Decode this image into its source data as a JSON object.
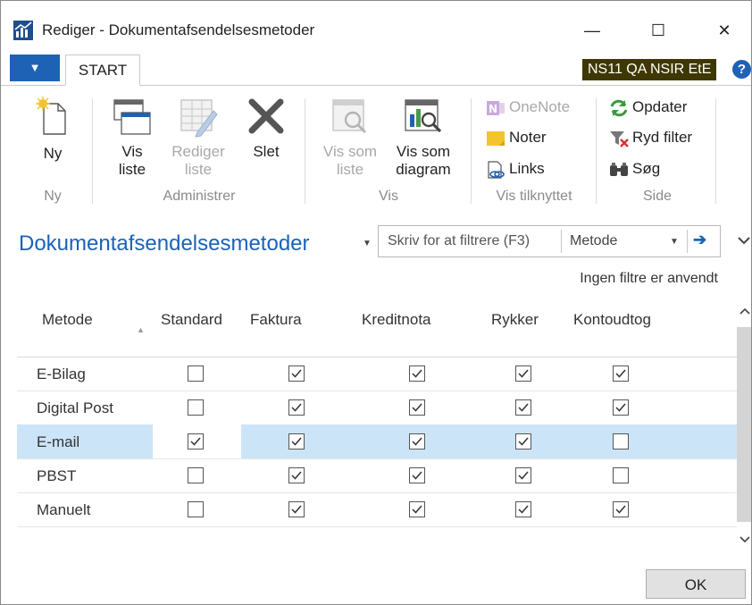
{
  "window": {
    "title": "Rediger - Dokumentafsendelsesmetoder",
    "minimize_glyph": "—",
    "maximize_glyph": "☐",
    "close_glyph": "✕"
  },
  "tabs": {
    "menu_glyph": "▼",
    "start_label": "START",
    "company": "NS11 QA NSIR EtE",
    "help_glyph": "?"
  },
  "ribbon": {
    "new_label": "Ny",
    "view_list_label": [
      "Vis",
      "liste"
    ],
    "edit_list_label": [
      "Rediger",
      "liste"
    ],
    "delete_label": "Slet",
    "view_as_list_label": [
      "Vis som",
      "liste"
    ],
    "view_as_chart_label": [
      "Vis som",
      "diagram"
    ],
    "onenote_label": "OneNote",
    "notes_label": "Noter",
    "links_label": "Links",
    "refresh_label": "Opdater",
    "clear_filter_label": "Ryd filter",
    "find_label": "Søg",
    "groups": {
      "new": "Ny",
      "manage": "Administrer",
      "view": "Vis",
      "show_attached": "Vis tilknyttet",
      "page": "Side"
    }
  },
  "page": {
    "title": "Dokumentafsendelsesmetoder",
    "filter_placeholder": "Skriv for at filtrere (F3)",
    "filter_field": "Metode",
    "no_filters": "Ingen filtre er anvendt"
  },
  "grid": {
    "columns": [
      "Metode",
      "Standard",
      "Faktura",
      "Kreditnota",
      "Rykker",
      "Kontoudtog"
    ],
    "rows": [
      {
        "name": "E-Bilag",
        "values": [
          false,
          true,
          true,
          true,
          true
        ],
        "selected": false
      },
      {
        "name": "Digital Post",
        "values": [
          false,
          true,
          true,
          true,
          true
        ],
        "selected": false
      },
      {
        "name": "E-mail",
        "values": [
          true,
          true,
          true,
          true,
          false
        ],
        "selected": true
      },
      {
        "name": "PBST",
        "values": [
          false,
          true,
          true,
          true,
          false
        ],
        "selected": false
      },
      {
        "name": "Manuelt",
        "values": [
          false,
          true,
          true,
          true,
          true
        ],
        "selected": false
      }
    ]
  },
  "footer": {
    "ok_label": "OK"
  },
  "colors": {
    "accent": "#1e62b6",
    "title_blue": "#1a62b8",
    "selected_row": "#cce4f7",
    "company_bg": "#3f3700"
  }
}
